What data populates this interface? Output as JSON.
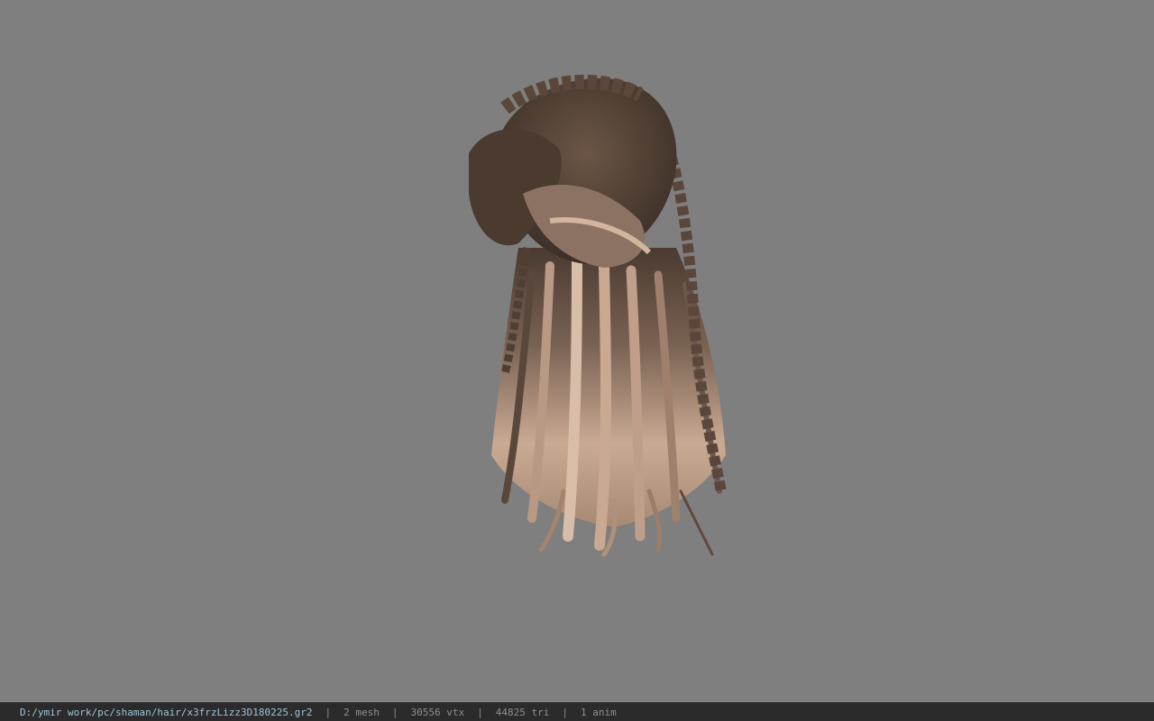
{
  "viewport": {
    "background_color": "#7f7f7f",
    "model": {
      "icon": "hair-model-render",
      "hair_dark_color": "#4a3a30",
      "hair_light_color": "#c9aa93"
    }
  },
  "status_bar": {
    "file_path": "D:/ymir work/pc/shaman/hair/x3frzLizz3D180225.gr2",
    "separator": "|",
    "mesh": "2 mesh",
    "vertices": "30556 vtx",
    "triangles": "44825 tri",
    "animations": "1 anim"
  }
}
